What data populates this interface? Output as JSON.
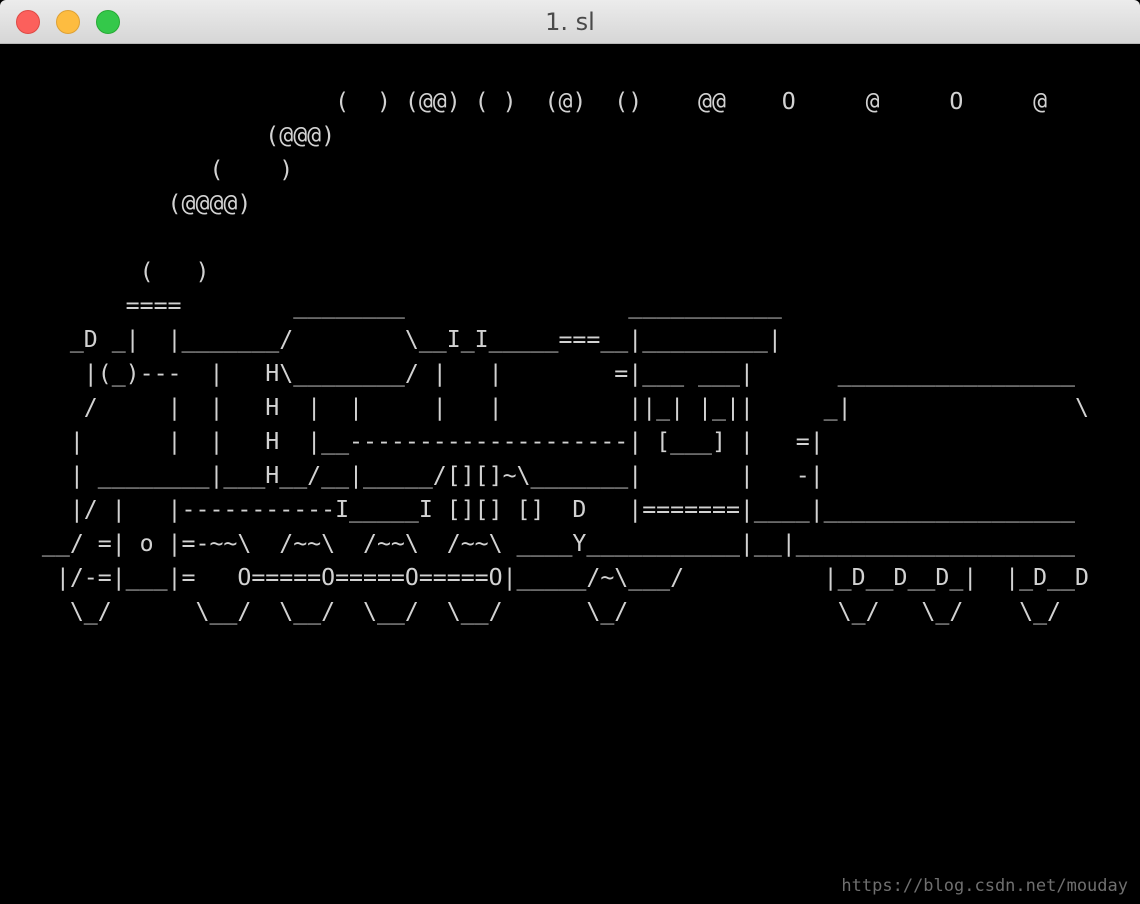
{
  "window": {
    "title": "1. sl"
  },
  "terminal": {
    "lines": [
      "                       (  ) (@@) ( )  (@)  ()    @@    O     @     O     @",
      "                  (@@@)",
      "              (    )",
      "           (@@@@)",
      "",
      "         (   )",
      "        ====        ________                ___________",
      "    _D _|  |_______/        \\__I_I_____===__|_________|",
      "     |(_)---  |   H\\________/ |   |        =|___ ___|      _________________",
      "     /     |  |   H  |  |     |   |         ||_| |_||     _|                \\",
      "    |      |  |   H  |__--------------------| [___] |   =|",
      "    | ________|___H__/__|_____/[][]~\\_______|       |   -|",
      "    |/ |   |-----------I_____I [][] []  D   |=======|____|__________________",
      "  __/ =| o |=-~~\\  /~~\\  /~~\\  /~~\\ ____Y___________|__|____________________",
      "   |/-=|___|=   O=====O=====O=====O|_____/~\\___/          |_D__D__D_|  |_D__D",
      "    \\_/      \\__/  \\__/  \\__/  \\__/      \\_/               \\_/   \\_/    \\_/"
    ]
  },
  "watermark": "https://blog.csdn.net/mouday"
}
